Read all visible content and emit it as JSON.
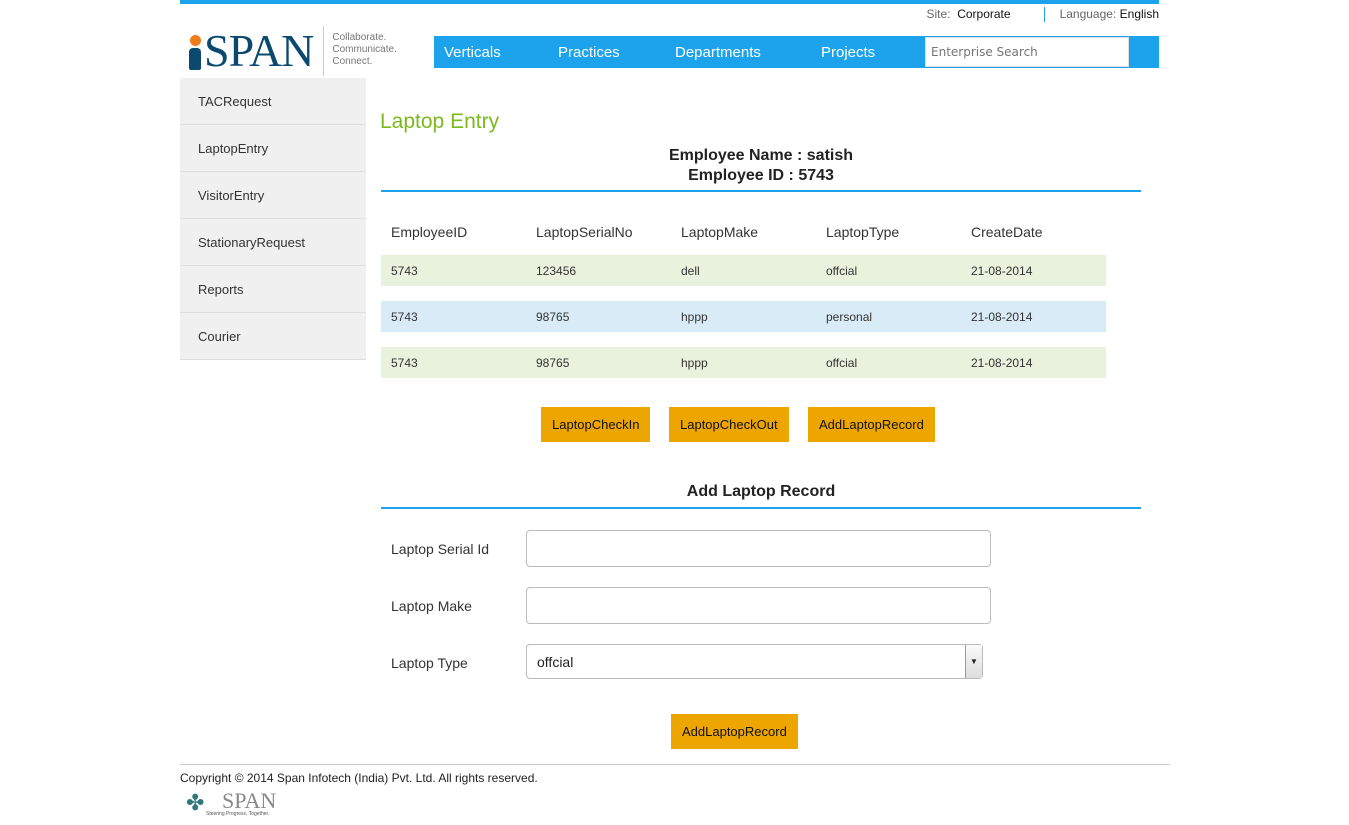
{
  "header": {
    "site_label": "Site:",
    "site_value": "Corporate",
    "language_label": "Language:",
    "language_value": "English",
    "logo_text": "SPAN",
    "tagline": [
      "Collaborate.",
      "Communicate.",
      "Connect."
    ],
    "nav": [
      "Verticals",
      "Practices",
      "Departments",
      "Projects"
    ],
    "search_placeholder": "Enterprise Search"
  },
  "sidebar": [
    "TACRequest",
    "LaptopEntry",
    "VisitorEntry",
    "StationaryRequest",
    "Reports",
    "Courier"
  ],
  "main": {
    "title": "Laptop Entry",
    "employee_name": "Employee Name : satish",
    "employee_id": "Employee ID : 5743",
    "table": {
      "headers": [
        "EmployeeID",
        "LaptopSerialNo",
        "LaptopMake",
        "LaptopType",
        "CreateDate"
      ],
      "rows": [
        [
          "5743",
          "123456",
          "dell",
          "offcial",
          "21-08-2014"
        ],
        [
          "5743",
          "98765",
          "hppp",
          "personal",
          "21-08-2014"
        ],
        [
          "5743",
          "98765",
          "hppp",
          "offcial",
          "21-08-2014"
        ]
      ]
    },
    "buttons": {
      "checkin": "LaptopCheckIn",
      "checkout": "LaptopCheckOut",
      "add": "AddLaptopRecord"
    },
    "form": {
      "title": "Add Laptop Record",
      "serial_label": "Laptop Serial Id",
      "serial_value": "",
      "make_label": "Laptop Make",
      "make_value": "",
      "type_label": "Laptop Type",
      "type_value": "offcial",
      "submit": "AddLaptopRecord"
    }
  },
  "footer": {
    "copyright": "Copyright © 2014 Span Infotech (India) Pvt. Ltd. All rights reserved.",
    "logo_text": "SPAN",
    "logo_tagline": "Steering Progress. Together."
  }
}
